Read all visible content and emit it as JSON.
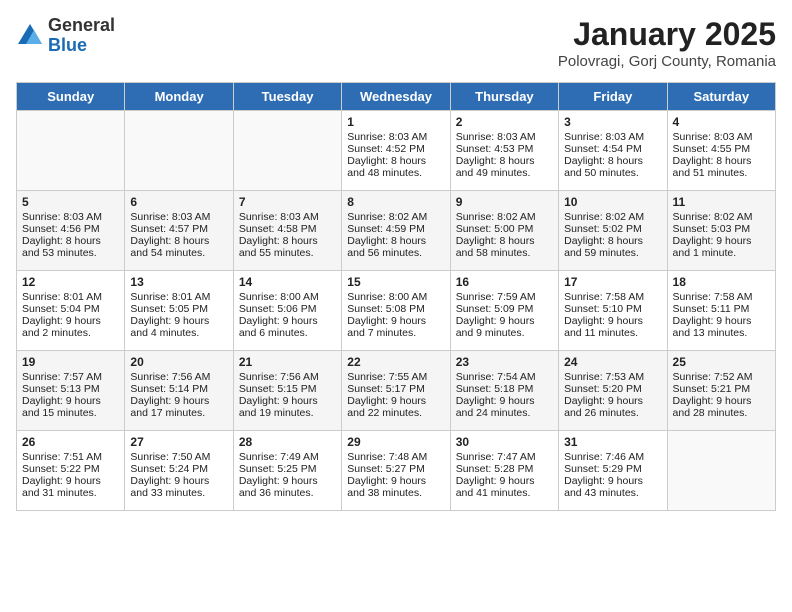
{
  "logo": {
    "general": "General",
    "blue": "Blue"
  },
  "title": "January 2025",
  "subtitle": "Polovragi, Gorj County, Romania",
  "days_of_week": [
    "Sunday",
    "Monday",
    "Tuesday",
    "Wednesday",
    "Thursday",
    "Friday",
    "Saturday"
  ],
  "weeks": [
    [
      {
        "day": "",
        "content": ""
      },
      {
        "day": "",
        "content": ""
      },
      {
        "day": "",
        "content": ""
      },
      {
        "day": "1",
        "content": "Sunrise: 8:03 AM\nSunset: 4:52 PM\nDaylight: 8 hours\nand 48 minutes."
      },
      {
        "day": "2",
        "content": "Sunrise: 8:03 AM\nSunset: 4:53 PM\nDaylight: 8 hours\nand 49 minutes."
      },
      {
        "day": "3",
        "content": "Sunrise: 8:03 AM\nSunset: 4:54 PM\nDaylight: 8 hours\nand 50 minutes."
      },
      {
        "day": "4",
        "content": "Sunrise: 8:03 AM\nSunset: 4:55 PM\nDaylight: 8 hours\nand 51 minutes."
      }
    ],
    [
      {
        "day": "5",
        "content": "Sunrise: 8:03 AM\nSunset: 4:56 PM\nDaylight: 8 hours\nand 53 minutes."
      },
      {
        "day": "6",
        "content": "Sunrise: 8:03 AM\nSunset: 4:57 PM\nDaylight: 8 hours\nand 54 minutes."
      },
      {
        "day": "7",
        "content": "Sunrise: 8:03 AM\nSunset: 4:58 PM\nDaylight: 8 hours\nand 55 minutes."
      },
      {
        "day": "8",
        "content": "Sunrise: 8:02 AM\nSunset: 4:59 PM\nDaylight: 8 hours\nand 56 minutes."
      },
      {
        "day": "9",
        "content": "Sunrise: 8:02 AM\nSunset: 5:00 PM\nDaylight: 8 hours\nand 58 minutes."
      },
      {
        "day": "10",
        "content": "Sunrise: 8:02 AM\nSunset: 5:02 PM\nDaylight: 8 hours\nand 59 minutes."
      },
      {
        "day": "11",
        "content": "Sunrise: 8:02 AM\nSunset: 5:03 PM\nDaylight: 9 hours\nand 1 minute."
      }
    ],
    [
      {
        "day": "12",
        "content": "Sunrise: 8:01 AM\nSunset: 5:04 PM\nDaylight: 9 hours\nand 2 minutes."
      },
      {
        "day": "13",
        "content": "Sunrise: 8:01 AM\nSunset: 5:05 PM\nDaylight: 9 hours\nand 4 minutes."
      },
      {
        "day": "14",
        "content": "Sunrise: 8:00 AM\nSunset: 5:06 PM\nDaylight: 9 hours\nand 6 minutes."
      },
      {
        "day": "15",
        "content": "Sunrise: 8:00 AM\nSunset: 5:08 PM\nDaylight: 9 hours\nand 7 minutes."
      },
      {
        "day": "16",
        "content": "Sunrise: 7:59 AM\nSunset: 5:09 PM\nDaylight: 9 hours\nand 9 minutes."
      },
      {
        "day": "17",
        "content": "Sunrise: 7:58 AM\nSunset: 5:10 PM\nDaylight: 9 hours\nand 11 minutes."
      },
      {
        "day": "18",
        "content": "Sunrise: 7:58 AM\nSunset: 5:11 PM\nDaylight: 9 hours\nand 13 minutes."
      }
    ],
    [
      {
        "day": "19",
        "content": "Sunrise: 7:57 AM\nSunset: 5:13 PM\nDaylight: 9 hours\nand 15 minutes."
      },
      {
        "day": "20",
        "content": "Sunrise: 7:56 AM\nSunset: 5:14 PM\nDaylight: 9 hours\nand 17 minutes."
      },
      {
        "day": "21",
        "content": "Sunrise: 7:56 AM\nSunset: 5:15 PM\nDaylight: 9 hours\nand 19 minutes."
      },
      {
        "day": "22",
        "content": "Sunrise: 7:55 AM\nSunset: 5:17 PM\nDaylight: 9 hours\nand 22 minutes."
      },
      {
        "day": "23",
        "content": "Sunrise: 7:54 AM\nSunset: 5:18 PM\nDaylight: 9 hours\nand 24 minutes."
      },
      {
        "day": "24",
        "content": "Sunrise: 7:53 AM\nSunset: 5:20 PM\nDaylight: 9 hours\nand 26 minutes."
      },
      {
        "day": "25",
        "content": "Sunrise: 7:52 AM\nSunset: 5:21 PM\nDaylight: 9 hours\nand 28 minutes."
      }
    ],
    [
      {
        "day": "26",
        "content": "Sunrise: 7:51 AM\nSunset: 5:22 PM\nDaylight: 9 hours\nand 31 minutes."
      },
      {
        "day": "27",
        "content": "Sunrise: 7:50 AM\nSunset: 5:24 PM\nDaylight: 9 hours\nand 33 minutes."
      },
      {
        "day": "28",
        "content": "Sunrise: 7:49 AM\nSunset: 5:25 PM\nDaylight: 9 hours\nand 36 minutes."
      },
      {
        "day": "29",
        "content": "Sunrise: 7:48 AM\nSunset: 5:27 PM\nDaylight: 9 hours\nand 38 minutes."
      },
      {
        "day": "30",
        "content": "Sunrise: 7:47 AM\nSunset: 5:28 PM\nDaylight: 9 hours\nand 41 minutes."
      },
      {
        "day": "31",
        "content": "Sunrise: 7:46 AM\nSunset: 5:29 PM\nDaylight: 9 hours\nand 43 minutes."
      },
      {
        "day": "",
        "content": ""
      }
    ]
  ]
}
